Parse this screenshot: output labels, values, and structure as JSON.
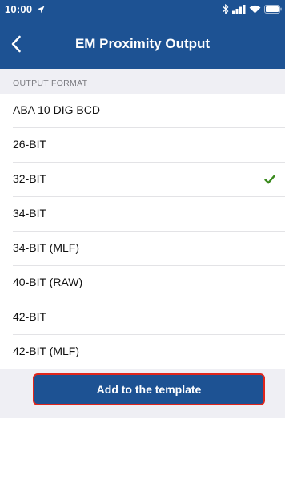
{
  "status_bar": {
    "time": "10:00",
    "location_icon": "location-arrow-icon",
    "bluetooth_icon": "bluetooth-icon",
    "signal_icon": "cellular-signal-icon",
    "wifi_icon": "wifi-icon",
    "battery_icon": "battery-icon"
  },
  "nav": {
    "title": "EM Proximity Output",
    "back_icon": "chevron-left-icon"
  },
  "section": {
    "header": "OUTPUT FORMAT"
  },
  "options": [
    {
      "label": "ABA 10 DIG BCD",
      "selected": false
    },
    {
      "label": "26-BIT",
      "selected": false
    },
    {
      "label": "32-BIT",
      "selected": true
    },
    {
      "label": "34-BIT",
      "selected": false
    },
    {
      "label": "34-BIT (MLF)",
      "selected": false
    },
    {
      "label": "40-BIT (RAW)",
      "selected": false
    },
    {
      "label": "42-BIT",
      "selected": false
    },
    {
      "label": "42-BIT (MLF)",
      "selected": false
    }
  ],
  "actions": {
    "add_label": "Add to the template"
  },
  "colors": {
    "brand_blue": "#1d5293",
    "check_green": "#3b8a1e",
    "button_border": "#e0261c",
    "group_background": "#efeff4"
  }
}
